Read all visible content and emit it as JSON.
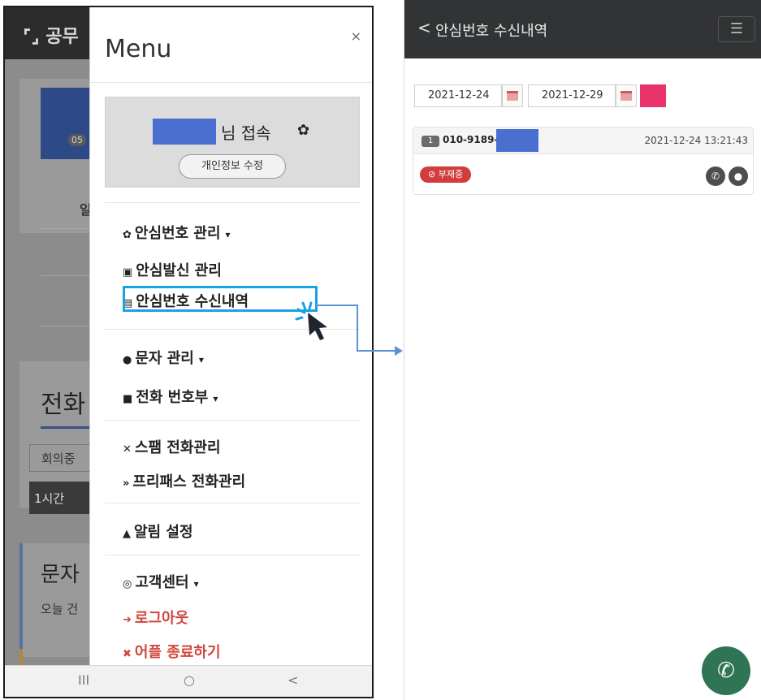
{
  "left_phone": {
    "background": {
      "app_title": "공무",
      "badge": "05",
      "char": "일",
      "tab_title": "전화",
      "field_value": "회의중",
      "button_label": "1시간",
      "message_title": "문자",
      "message_sub": "오늘 건"
    },
    "menu": {
      "title": "Menu",
      "close": "×",
      "user_greeting": "님 접속",
      "profile_edit": "개인정보 수정",
      "items": [
        {
          "label": "안심번호 관리",
          "icon": "✿",
          "caret": "▾"
        },
        {
          "label": "안심발신 관리",
          "icon": "▣"
        },
        {
          "label": "안심번호 수신내역",
          "icon": "▤"
        },
        {
          "label": "문자 관리",
          "icon": "●",
          "caret": "▾"
        },
        {
          "label": "전화 번호부",
          "icon": "■",
          "caret": "▾"
        },
        {
          "label": "스팸 전화관리",
          "icon": "✕"
        },
        {
          "label": "프리패스 전화관리",
          "icon": "»"
        },
        {
          "label": "알림 설정",
          "icon": "▲"
        },
        {
          "label": "고객센터",
          "icon": "◎",
          "caret": "▾"
        },
        {
          "label": "로그아웃",
          "icon": "➜"
        },
        {
          "label": "어플 종료하기",
          "icon": "✖"
        }
      ]
    },
    "navbar": {
      "recent": "III",
      "home": "○",
      "back": "<"
    }
  },
  "right_phone": {
    "header": {
      "back": "<",
      "title": "안심번호 수신내역",
      "menu": "☰"
    },
    "date_from": "2021-12-24",
    "date_to": "2021-12-29",
    "records": [
      {
        "index": "1",
        "phone": "010-9189-0",
        "time": "2021-12-24 13:21:43",
        "status": "⊘ 부재중"
      }
    ]
  },
  "colors": {
    "highlight": "#1aa3e0",
    "fab": "#2f7454",
    "search": "#e8336b",
    "status_red": "#d23c3c",
    "mask_blue": "#4a6fd0"
  }
}
